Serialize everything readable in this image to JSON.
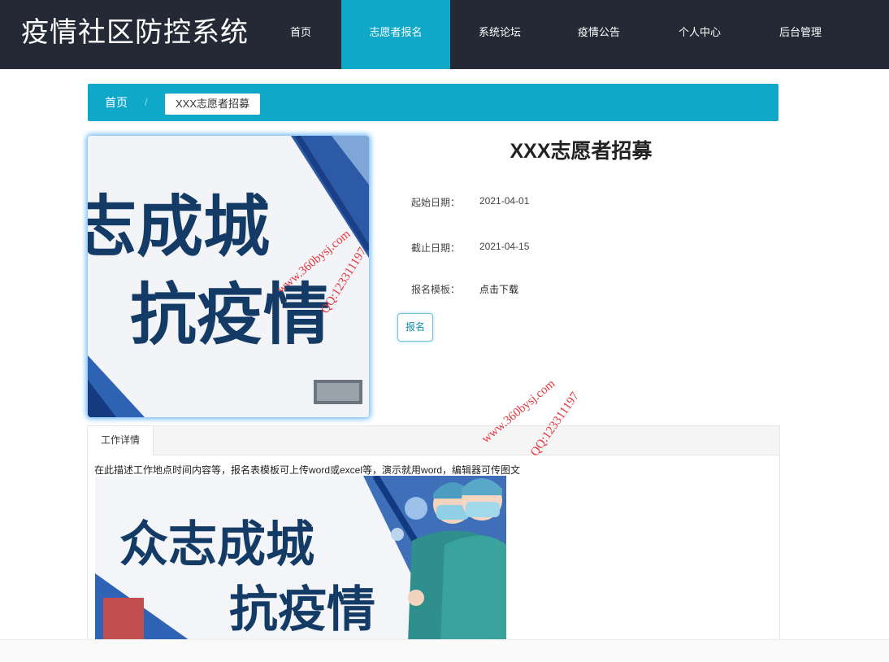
{
  "header": {
    "site_title": "疫情社区防控系统",
    "nav": [
      {
        "label": "首页"
      },
      {
        "label": "志愿者报名"
      },
      {
        "label": "系统论坛"
      },
      {
        "label": "疫情公告"
      },
      {
        "label": "个人中心"
      },
      {
        "label": "后台管理"
      }
    ],
    "active_nav": "志愿者报名"
  },
  "breadcrumb": {
    "home": "首页",
    "separator": "/",
    "current": "XXX志愿者招募"
  },
  "poster": {
    "line1": "志成城",
    "line2": "抗疫情"
  },
  "info": {
    "title": "XXX志愿者招募",
    "start_label": "起始日期：",
    "start_value": "2021-04-01",
    "end_label": "截止日期：",
    "end_value": "2021-04-15",
    "template_label": "报名模板：",
    "template_link": "点击下载",
    "apply_button": "报名"
  },
  "tabs": {
    "active_tab": "工作详情",
    "description": "在此描述工作地点时间内容等，报名表模板可上传word或excel等，演示就用word，编辑器可传图文",
    "image_line1": "众志成城",
    "image_line2": "抗疫情"
  },
  "watermark": {
    "site": "www.360bysj.com",
    "qq": "QQ:123311197"
  },
  "colors": {
    "header_bg": "#232a36",
    "accent": "#0fa8c9",
    "poster_text": "#143a66",
    "watermark": "#e8343c"
  }
}
